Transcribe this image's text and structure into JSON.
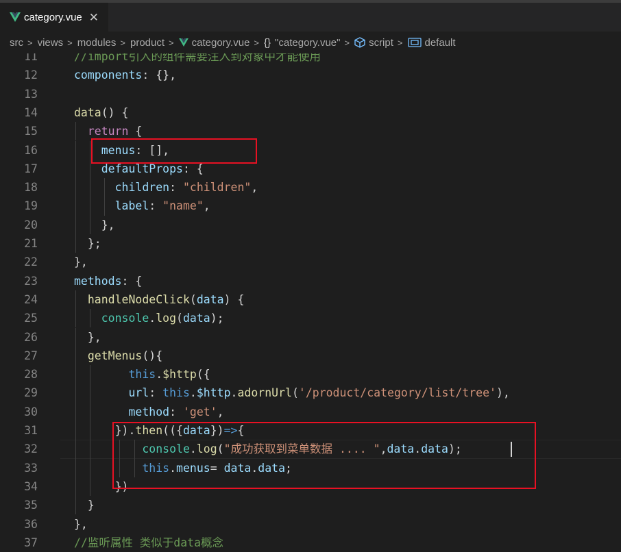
{
  "tab": {
    "filename": "category.vue",
    "close": "✕"
  },
  "breadcrumb": {
    "items": [
      "src",
      "views",
      "modules",
      "product",
      "category.vue",
      "\"category.vue\"",
      "script",
      "default"
    ],
    "braces": "{}"
  },
  "colors": {
    "highlight_box": "#e81123",
    "vue_logo": "#41b883"
  },
  "lines": [
    {
      "n": "11",
      "seg": [
        {
          "c": "cmt",
          "t": "//import引入的组件需要注入到对象中才能使用"
        }
      ]
    },
    {
      "n": "12",
      "seg": [
        {
          "c": "prop",
          "t": "components"
        },
        {
          "c": "p",
          "t": ": {},"
        }
      ]
    },
    {
      "n": "13",
      "seg": []
    },
    {
      "n": "14",
      "seg": [
        {
          "c": "fn",
          "t": "data"
        },
        {
          "c": "p",
          "t": "() {"
        }
      ]
    },
    {
      "n": "15",
      "seg": [
        {
          "c": "p",
          "t": "  "
        },
        {
          "c": "kw",
          "t": "return"
        },
        {
          "c": "p",
          "t": " {"
        }
      ]
    },
    {
      "n": "16",
      "seg": [
        {
          "c": "p",
          "t": "    "
        },
        {
          "c": "prop",
          "t": "menus"
        },
        {
          "c": "p",
          "t": ": [],"
        }
      ]
    },
    {
      "n": "17",
      "seg": [
        {
          "c": "p",
          "t": "    "
        },
        {
          "c": "prop",
          "t": "defaultProps"
        },
        {
          "c": "p",
          "t": ": {"
        }
      ]
    },
    {
      "n": "18",
      "seg": [
        {
          "c": "p",
          "t": "      "
        },
        {
          "c": "prop",
          "t": "children"
        },
        {
          "c": "p",
          "t": ": "
        },
        {
          "c": "str",
          "t": "\"children\""
        },
        {
          "c": "p",
          "t": ","
        }
      ]
    },
    {
      "n": "19",
      "seg": [
        {
          "c": "p",
          "t": "      "
        },
        {
          "c": "prop",
          "t": "label"
        },
        {
          "c": "p",
          "t": ": "
        },
        {
          "c": "str",
          "t": "\"name\""
        },
        {
          "c": "p",
          "t": ","
        }
      ]
    },
    {
      "n": "20",
      "seg": [
        {
          "c": "p",
          "t": "    },"
        }
      ]
    },
    {
      "n": "21",
      "seg": [
        {
          "c": "p",
          "t": "  };"
        }
      ]
    },
    {
      "n": "22",
      "seg": [
        {
          "c": "p",
          "t": "},"
        }
      ]
    },
    {
      "n": "23",
      "seg": [
        {
          "c": "prop",
          "t": "methods"
        },
        {
          "c": "p",
          "t": ": {"
        }
      ]
    },
    {
      "n": "24",
      "seg": [
        {
          "c": "p",
          "t": "  "
        },
        {
          "c": "fn",
          "t": "handleNodeClick"
        },
        {
          "c": "p",
          "t": "("
        },
        {
          "c": "prop",
          "t": "data"
        },
        {
          "c": "p",
          "t": ") {"
        }
      ]
    },
    {
      "n": "25",
      "seg": [
        {
          "c": "p",
          "t": "    "
        },
        {
          "c": "cls",
          "t": "console"
        },
        {
          "c": "p",
          "t": "."
        },
        {
          "c": "fn",
          "t": "log"
        },
        {
          "c": "p",
          "t": "("
        },
        {
          "c": "prop",
          "t": "data"
        },
        {
          "c": "p",
          "t": ");"
        }
      ]
    },
    {
      "n": "26",
      "seg": [
        {
          "c": "p",
          "t": "  },"
        }
      ]
    },
    {
      "n": "27",
      "seg": [
        {
          "c": "p",
          "t": "  "
        },
        {
          "c": "fn",
          "t": "getMenus"
        },
        {
          "c": "p",
          "t": "(){"
        }
      ]
    },
    {
      "n": "28",
      "seg": [
        {
          "c": "p",
          "t": "        "
        },
        {
          "c": "this",
          "t": "this"
        },
        {
          "c": "p",
          "t": "."
        },
        {
          "c": "fn",
          "t": "$http"
        },
        {
          "c": "p",
          "t": "({"
        }
      ]
    },
    {
      "n": "29",
      "seg": [
        {
          "c": "p",
          "t": "        "
        },
        {
          "c": "prop",
          "t": "url"
        },
        {
          "c": "p",
          "t": ": "
        },
        {
          "c": "this",
          "t": "this"
        },
        {
          "c": "p",
          "t": "."
        },
        {
          "c": "prop",
          "t": "$http"
        },
        {
          "c": "p",
          "t": "."
        },
        {
          "c": "fn",
          "t": "adornUrl"
        },
        {
          "c": "p",
          "t": "("
        },
        {
          "c": "str",
          "t": "'/product/category/list/tree'"
        },
        {
          "c": "p",
          "t": "),"
        }
      ]
    },
    {
      "n": "30",
      "seg": [
        {
          "c": "p",
          "t": "        "
        },
        {
          "c": "prop",
          "t": "method"
        },
        {
          "c": "p",
          "t": ": "
        },
        {
          "c": "str",
          "t": "'get'"
        },
        {
          "c": "p",
          "t": ","
        }
      ]
    },
    {
      "n": "31",
      "seg": [
        {
          "c": "p",
          "t": "      })."
        },
        {
          "c": "fn",
          "t": "then"
        },
        {
          "c": "p",
          "t": "(({"
        },
        {
          "c": "prop",
          "t": "data"
        },
        {
          "c": "p",
          "t": "})"
        },
        {
          "c": "this",
          "t": "=>"
        },
        {
          "c": "p",
          "t": "{"
        }
      ]
    },
    {
      "n": "32",
      "seg": [
        {
          "c": "p",
          "t": "          "
        },
        {
          "c": "cls",
          "t": "console"
        },
        {
          "c": "p",
          "t": "."
        },
        {
          "c": "fn",
          "t": "log"
        },
        {
          "c": "p",
          "t": "("
        },
        {
          "c": "str",
          "t": "\"成功获取到菜单数据 .... \""
        },
        {
          "c": "p",
          "t": ","
        },
        {
          "c": "prop",
          "t": "data"
        },
        {
          "c": "p",
          "t": "."
        },
        {
          "c": "prop",
          "t": "data"
        },
        {
          "c": "p",
          "t": ");"
        }
      ]
    },
    {
      "n": "33",
      "seg": [
        {
          "c": "p",
          "t": "          "
        },
        {
          "c": "this",
          "t": "this"
        },
        {
          "c": "p",
          "t": "."
        },
        {
          "c": "prop",
          "t": "menus"
        },
        {
          "c": "p",
          "t": "= "
        },
        {
          "c": "prop",
          "t": "data"
        },
        {
          "c": "p",
          "t": "."
        },
        {
          "c": "prop",
          "t": "data"
        },
        {
          "c": "p",
          "t": ";"
        }
      ]
    },
    {
      "n": "34",
      "seg": [
        {
          "c": "p",
          "t": "      })"
        }
      ]
    },
    {
      "n": "35",
      "seg": [
        {
          "c": "p",
          "t": "  }"
        }
      ]
    },
    {
      "n": "36",
      "seg": [
        {
          "c": "p",
          "t": "},"
        }
      ]
    },
    {
      "n": "37",
      "seg": [
        {
          "c": "cmt",
          "t": "//监听属性 类似于data概念"
        }
      ]
    }
  ]
}
